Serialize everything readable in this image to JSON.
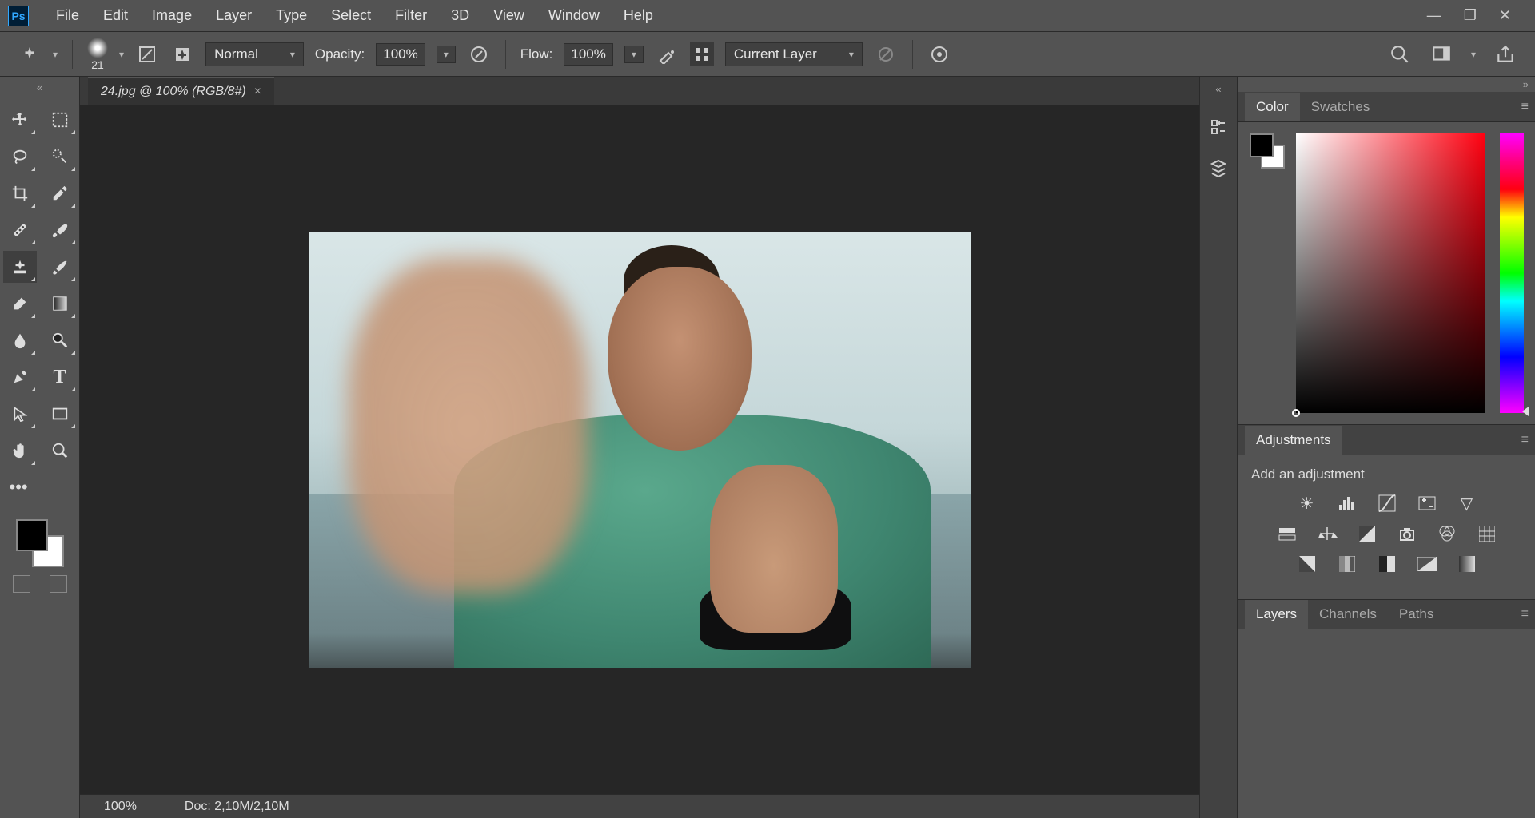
{
  "app": {
    "logo": "Ps"
  },
  "menu": [
    "File",
    "Edit",
    "Image",
    "Layer",
    "Type",
    "Select",
    "Filter",
    "3D",
    "View",
    "Window",
    "Help"
  ],
  "options": {
    "brush_size": "21",
    "blend_mode": "Normal",
    "opacity_label": "Opacity:",
    "opacity_value": "100%",
    "flow_label": "Flow:",
    "flow_value": "100%",
    "sample_mode": "Current Layer"
  },
  "document": {
    "tab_title": "24.jpg @ 100% (RGB/8#)",
    "zoom": "100%",
    "doc_info": "Doc: 2,10M/2,10M"
  },
  "panels": {
    "color_tab": "Color",
    "swatches_tab": "Swatches",
    "adjustments_tab": "Adjustments",
    "add_adjustment": "Add an adjustment",
    "layers_tab": "Layers",
    "channels_tab": "Channels",
    "paths_tab": "Paths"
  }
}
